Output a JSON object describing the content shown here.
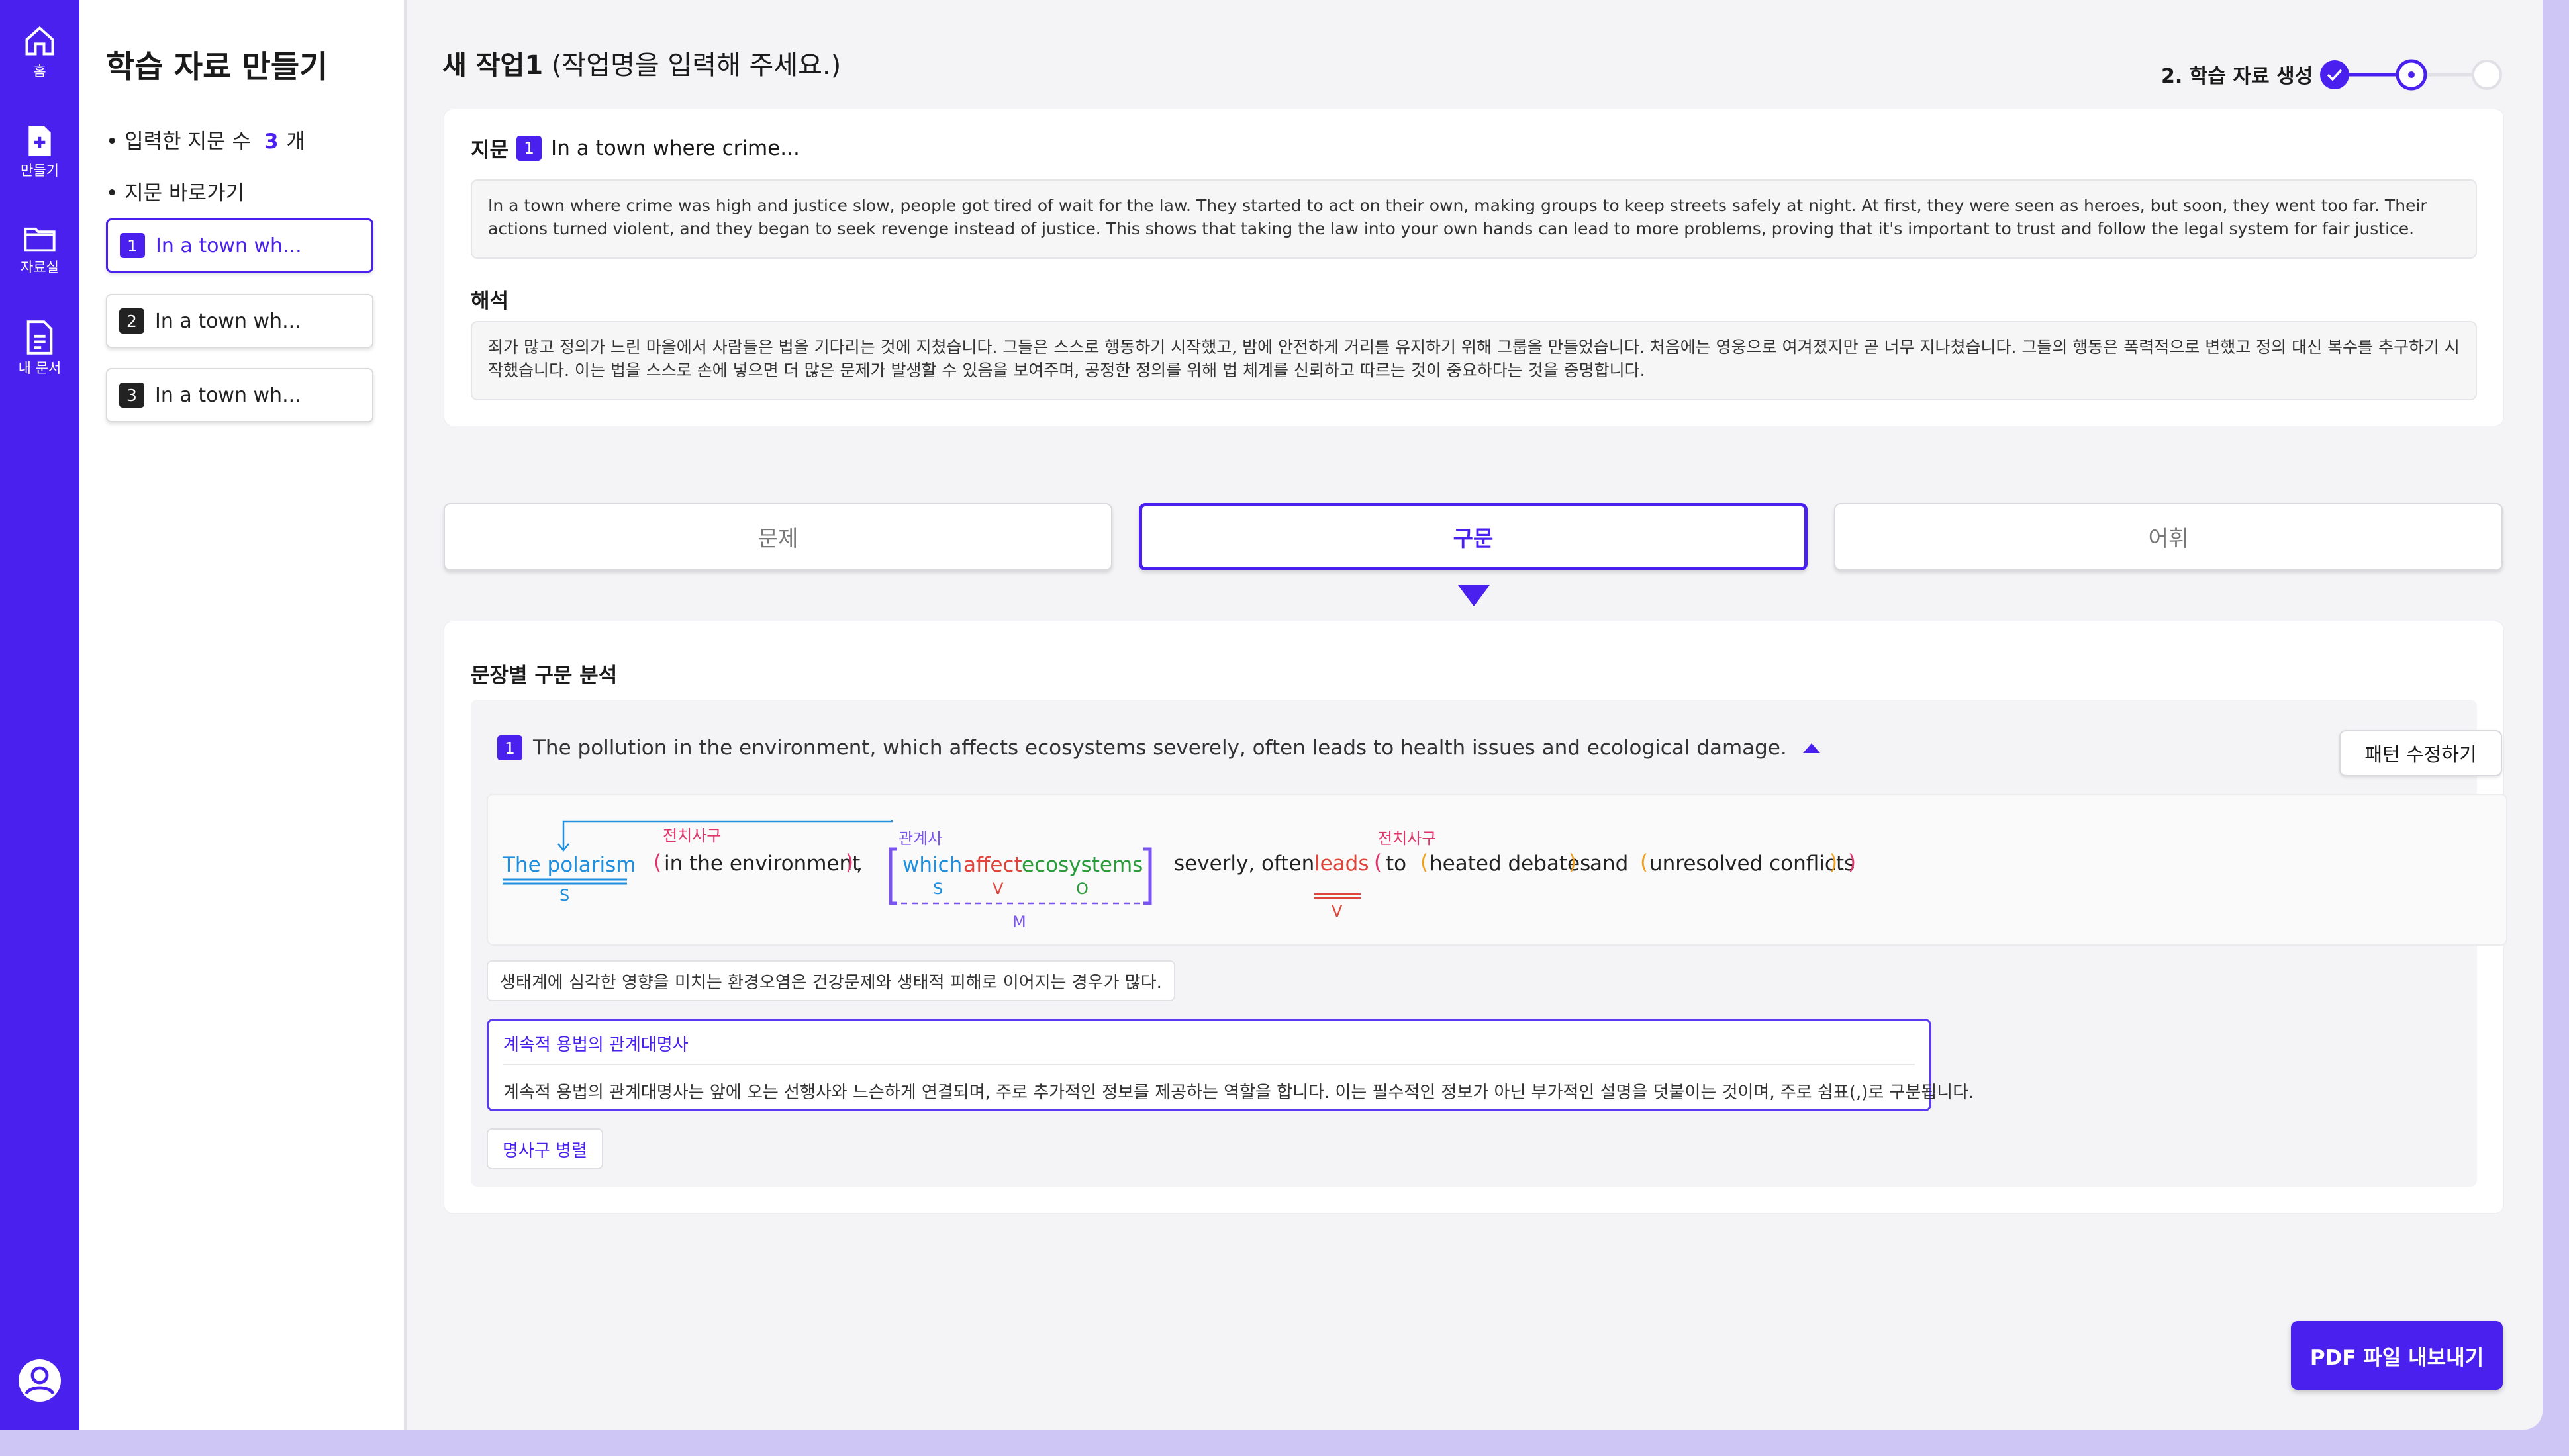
{
  "nav": {
    "items": [
      {
        "label": "홈",
        "icon": "home-icon"
      },
      {
        "label": "만들기",
        "icon": "file-plus-icon"
      },
      {
        "label": "자료실",
        "icon": "folder-icon"
      },
      {
        "label": "내 문서",
        "icon": "document-icon"
      }
    ],
    "profile_icon": "user-icon"
  },
  "sidebar": {
    "title": "학습 자료 만들기",
    "count_label": "• 입력한 지문 수",
    "count_value": "3",
    "count_unit": "개",
    "shortcut_label": "• 지문 바로가기",
    "items": [
      {
        "num": "1",
        "label": "In a town wh..."
      },
      {
        "num": "2",
        "label": "In a town wh..."
      },
      {
        "num": "3",
        "label": "In a town wh..."
      }
    ]
  },
  "header": {
    "job_title": "새 작업1",
    "job_hint": "(작업명을 입력해 주세요.)",
    "step_label": "2. 학습 자료 생성"
  },
  "passage": {
    "label": "지문",
    "num": "1",
    "title": "In a town where crime...",
    "text": "In a town where crime was high and justice slow, people got tired of wait for the law. They started to act on their own, making groups to keep streets safely at night. At first, they were seen as heroes, but soon, they went too far. Their actions turned violent, and they began to seek revenge instead of justice. This shows that taking the law into your own hands can lead to more problems, proving that it's important to trust and follow the legal system for fair justice.",
    "translation_label": "해석",
    "translation": "죄가 많고 정의가 느린 마을에서 사람들은 법을 기다리는 것에 지쳤습니다. 그들은 스스로 행동하기 시작했고, 밤에 안전하게 거리를 유지하기 위해 그룹을 만들었습니다. 처음에는 영웅으로 여겨졌지만 곧 너무 지나쳤습니다. 그들의 행동은 폭력적으로 변했고 정의 대신 복수를 추구하기 시작했습니다. 이는 법을 스스로 손에 넣으면 더 많은 문제가 발생할 수 있음을 보여주며, 공정한 정의를 위해 법 체계를 신뢰하고 따르는 것이 중요하다는 것을 증명합니다."
  },
  "tabs": [
    {
      "label": "문제"
    },
    {
      "label": "구문"
    },
    {
      "label": "어휘"
    }
  ],
  "analysis": {
    "title": "문장별 구문 분석",
    "sentence_num": "1",
    "sentence": "The pollution in the environment, which affects ecosystems severely, often leads to health issues and ecological damage.",
    "edit_button": "패턴 수정하기",
    "tokens": {
      "subject": "The polarism",
      "subject_tag": "S",
      "prep1_tag": "전치사구",
      "prep1": "in the environment",
      "comma": ",",
      "rel_tag": "관계사",
      "rel_which": "which",
      "rel_affect": "affect",
      "rel_ecosystems": "ecosystems",
      "rel_s": "S",
      "rel_v": "V",
      "rel_o": "O",
      "rel_m": "M",
      "adverbs": "severly, often",
      "verb": "leads",
      "verb_tag": "V",
      "prep2_tag": "전치사구",
      "prep2_to": "to",
      "np1": "heated debates",
      "and": "and",
      "np2": "unresolved conflicts",
      "period": "."
    },
    "translation": "생태계에 심각한 영향을 미치는 환경오염은 건강문제와 생태적 피해로 이어지는 경우가 많다.",
    "note_title": "계속적 용법의 관계대명사",
    "note_body": "계속적 용법의 관계대명사는 앞에 오는 선행사와 느슨하게 연결되며, 주로 추가적인 정보를 제공하는 역할을 합니다. 이는 필수적인 정보가 아닌 부가적인 설명을 덧붙이는 것이며, 주로 쉼표(,)로 구분됩니다.",
    "tag_label": "명사구 병렬"
  },
  "export_button": "PDF 파일 내보내기",
  "colors": {
    "accent": "#4a20ee",
    "subject": "#1f8fe0",
    "prep": "#e0336a",
    "verb": "#e0443a",
    "object": "#2a9d3a",
    "np": "#f0a020"
  }
}
